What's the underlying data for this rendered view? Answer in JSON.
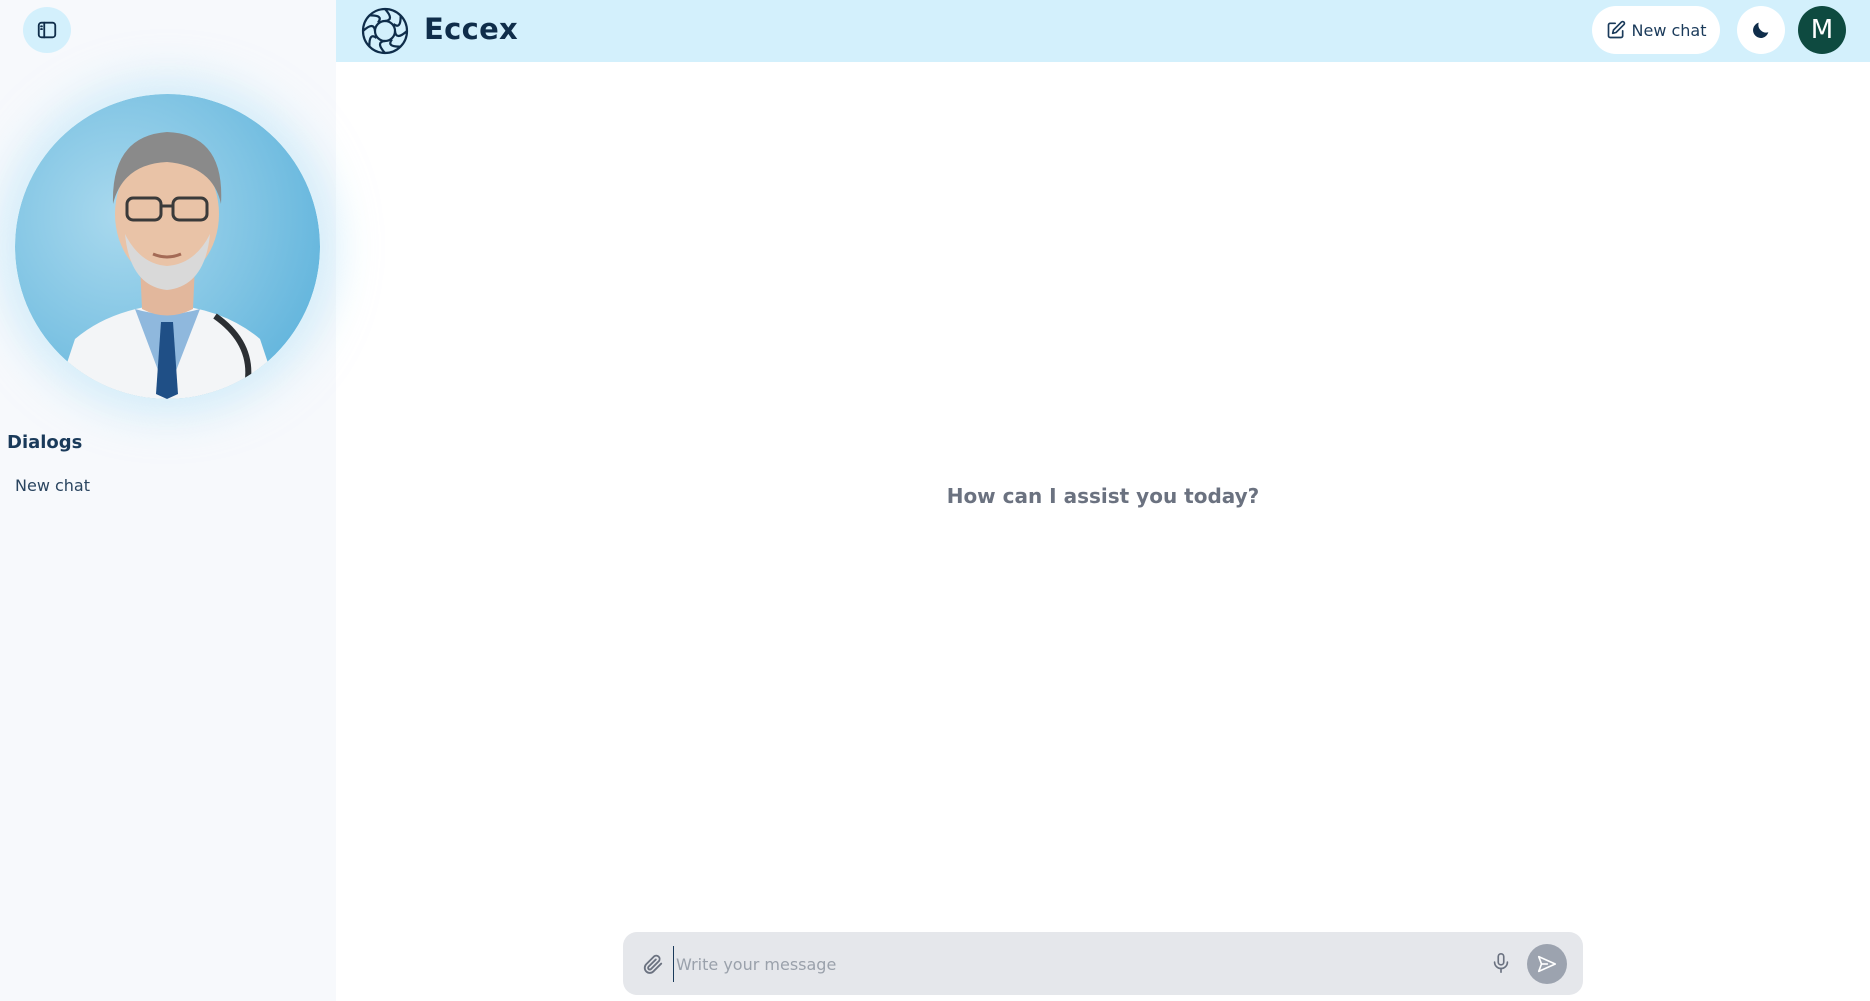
{
  "app": {
    "name": "Eccex",
    "brand_color": "#0f2d4a",
    "header_color": "#d3f0fc"
  },
  "header": {
    "new_chat_label": "New chat",
    "new_chat_icon": "edit-square-icon",
    "theme_icon": "moon-icon",
    "avatar_initial": "M",
    "avatar_color": "#0e4a40"
  },
  "sidebar": {
    "toggle_icon": "sidebar-panel-icon",
    "dialogs_heading": "Dialogs",
    "dialogs": [
      {
        "label": "New chat"
      }
    ]
  },
  "main": {
    "welcome_text": "How can I assist you today?"
  },
  "composer": {
    "placeholder": "Write your message",
    "value": "",
    "attach_icon": "paperclip-icon",
    "mic_icon": "microphone-icon",
    "send_icon": "send-icon"
  }
}
